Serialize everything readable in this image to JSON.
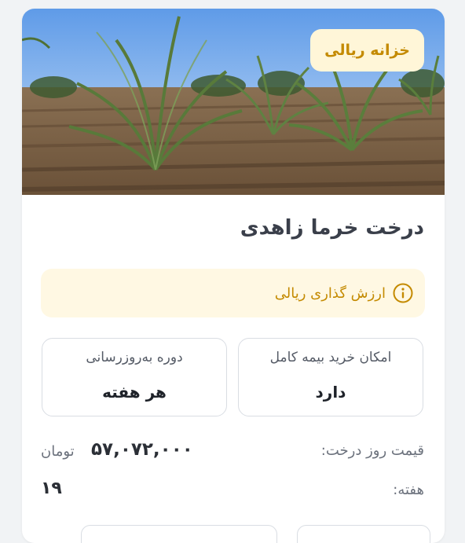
{
  "hero": {
    "badge": "خزانه ریالی",
    "image": "date-palm-orchard-photo"
  },
  "product": {
    "title": "درخت خرما زاهدی"
  },
  "notice": {
    "icon": "info-circle-icon",
    "text": "ارزش گذاری ریالی"
  },
  "info": {
    "insurance_label": "امکان خرید بیمه کامل",
    "insurance_value": "دارد",
    "update_label": "دوره به‌روزرسانی",
    "update_value": "هر هفته"
  },
  "price": {
    "label": "قیمت روز درخت:",
    "value": "۵۷,۰۷۲,۰۰۰",
    "unit": "تومان"
  },
  "week": {
    "label": "هفته:",
    "value": "۱۹"
  },
  "colors": {
    "accent": "#c48a00",
    "badge_bg": "#fff6d8",
    "notice_bg": "#fff8e3",
    "border": "#d9dde3"
  }
}
